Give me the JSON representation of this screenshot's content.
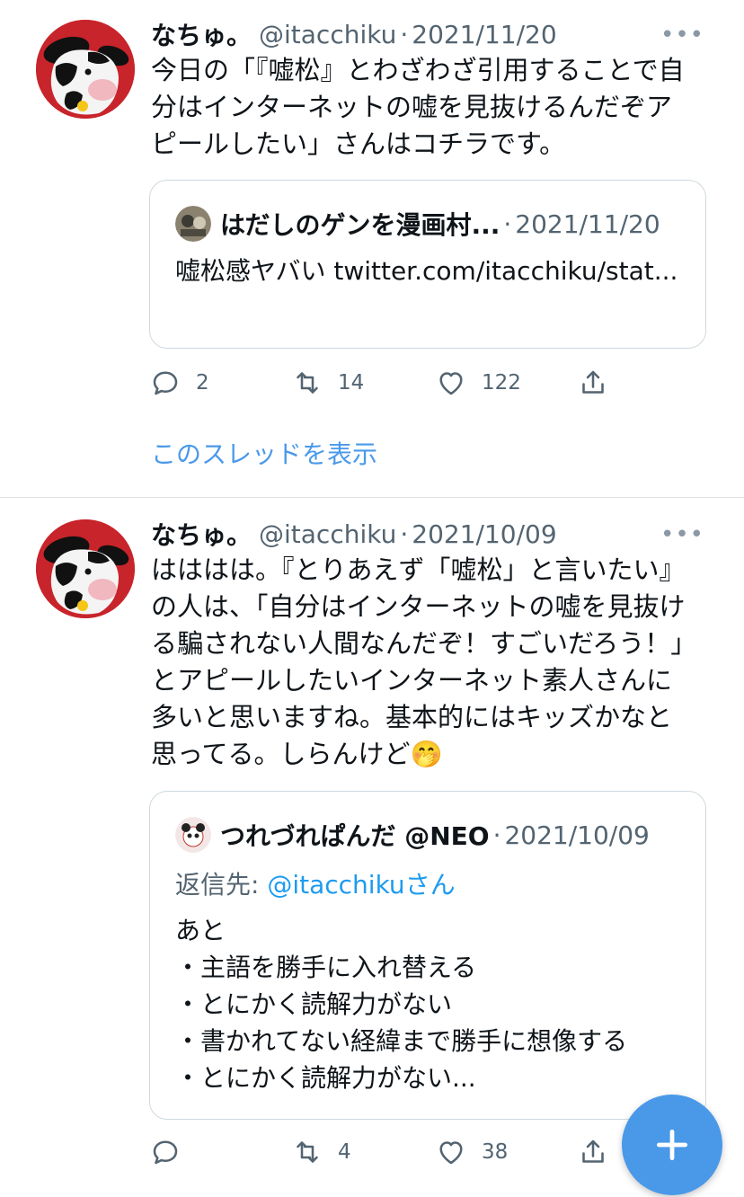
{
  "tweets": [
    {
      "name": "なちゅ。",
      "handle": "@itacchiku",
      "dot": "·",
      "date": "2021/11/20",
      "more": "•••",
      "text": "今日の「『嘘松』とわざわざ引用することで自分はインターネットの嘘を見抜けるんだぞアピールしたい」さんはコチラです。",
      "quote": {
        "name": "はだしのゲンを漫画村...",
        "dot": "·",
        "date": "2021/11/20",
        "text": "嘘松感ヤバい twitter.com/itacchiku/stat..."
      },
      "actions": {
        "reply": "2",
        "retweet": "14",
        "like": "122"
      },
      "thread_link": "このスレッドを表示"
    },
    {
      "name": "なちゅ。",
      "handle": "@itacchiku",
      "dot": "·",
      "date": "2021/10/09",
      "more": "•••",
      "text": "はははは。『とりあえず「嘘松」と言いたい』の人は、「自分はインターネットの嘘を見抜ける騙されない人間なんだぞ！すごいだろう！」とアピールしたいインターネット素人さんに多いと思いますね。基本的にはキッズかなと思ってる。しらんけど",
      "emoji": "🤭",
      "quote": {
        "name": "つれづれぱんだ @NEO",
        "dot": "·",
        "date": "2021/10/09",
        "reply_prefix": "返信先: ",
        "reply_to": "@itacchiku",
        "reply_suffix": "さん",
        "text": "あと\n・主語を勝手に入れ替える\n・とにかく読解力がない\n・書かれてない経緯まで勝手に想像する\n・とにかく読解力がない..."
      },
      "actions": {
        "reply": "",
        "retweet": "4",
        "like": "38"
      }
    }
  ],
  "fab": {
    "icon": "plus-icon"
  },
  "colors": {
    "accent": "#1d9bf0",
    "text": "#0f1419",
    "muted": "#536471",
    "border": "#cfd9de",
    "avatar_bg": "#c8242b"
  }
}
